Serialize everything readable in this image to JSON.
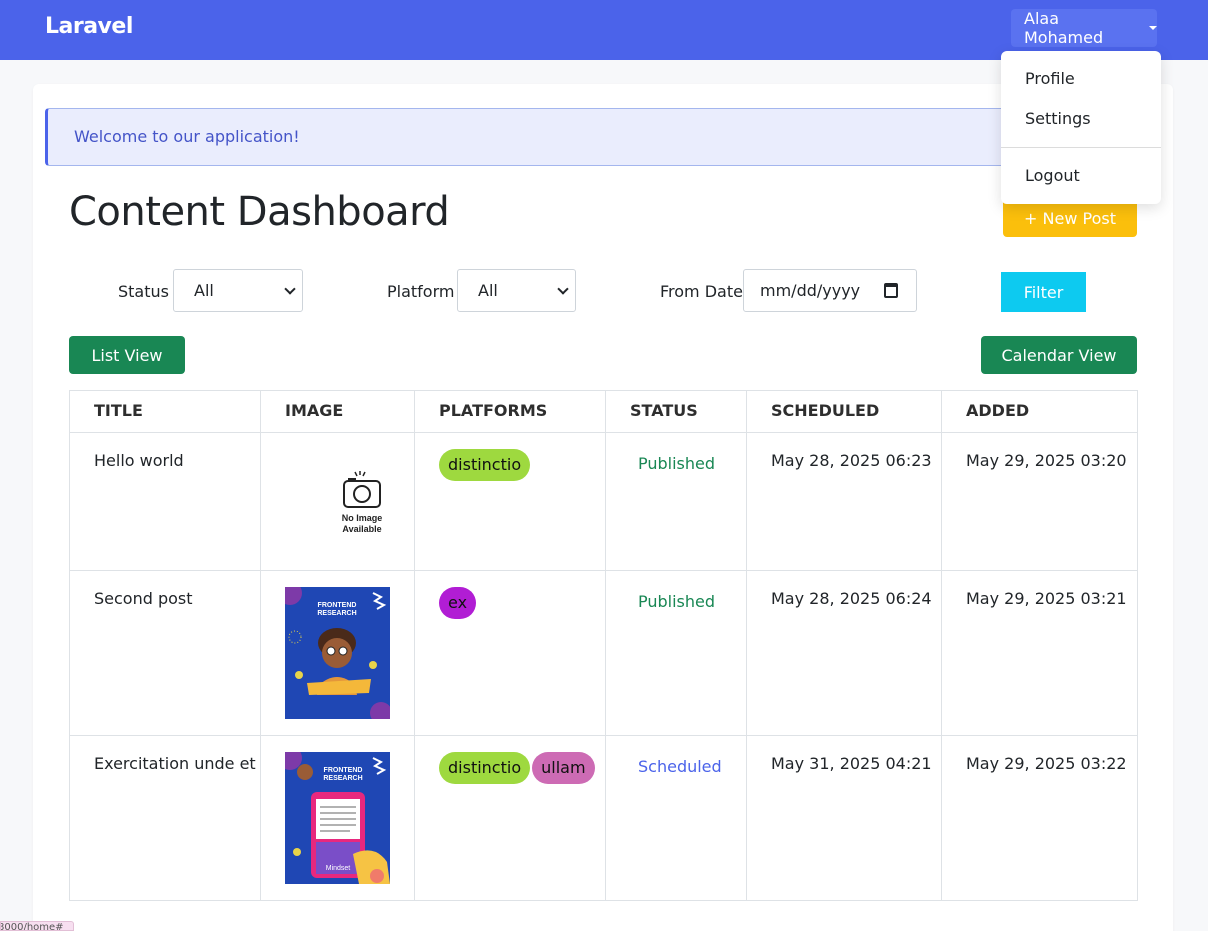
{
  "navbar": {
    "brand": "Laravel",
    "user_name": "Alaa Mohamed",
    "dropdown": {
      "items": [
        "Profile",
        "Settings"
      ],
      "logout": "Logout"
    }
  },
  "alert": {
    "message": "Welcome to our application!"
  },
  "page": {
    "title": "Content Dashboard",
    "new_post_label": "+ New Post"
  },
  "filters": {
    "status": {
      "label": "Status",
      "value": "All"
    },
    "platform": {
      "label": "Platform",
      "value": "All"
    },
    "from_date": {
      "label": "From Date",
      "placeholder": "mm/dd/yyyy"
    },
    "submit_label": "Filter"
  },
  "views": {
    "list_label": "List View",
    "calendar_label": "Calendar View"
  },
  "table": {
    "headers": [
      "TITLE",
      "IMAGE",
      "PLATFORMS",
      "STATUS",
      "SCHEDULED",
      "ADDED"
    ],
    "no_image": {
      "line1": "No Image",
      "line2": "Available"
    },
    "rows": [
      {
        "title": "Hello world",
        "image": "none",
        "platforms": [
          {
            "name": "distinctio",
            "color": "#9ed93f"
          }
        ],
        "status": "Published",
        "status_color": "#198754",
        "scheduled": "May 28, 2025 06:23",
        "added": "May 29, 2025 03:20"
      },
      {
        "title": "Second post",
        "image": "frontend-research-poster",
        "image_caption": {
          "line1": "FRONTEND",
          "line2": "RESEARCH"
        },
        "platforms": [
          {
            "name": "ex",
            "color": "#b11dd4"
          }
        ],
        "status": "Published",
        "status_color": "#198754",
        "scheduled": "May 28, 2025 06:24",
        "added": "May 29, 2025 03:21"
      },
      {
        "title": "Exercitation unde et",
        "image": "frontend-research-phone-poster",
        "image_caption": {
          "line1": "FRONTEND",
          "line2": "RESEARCH",
          "footer": "Mindset"
        },
        "platforms": [
          {
            "name": "distinctio",
            "color": "#9ed93f"
          },
          {
            "name": "ullam",
            "color": "#cd6bb4"
          }
        ],
        "status": "Scheduled",
        "status_color": "#4b63ea",
        "scheduled": "May 31, 2025 04:21",
        "added": "May 29, 2025 03:22"
      }
    ]
  },
  "url_hint": "8000/home#"
}
